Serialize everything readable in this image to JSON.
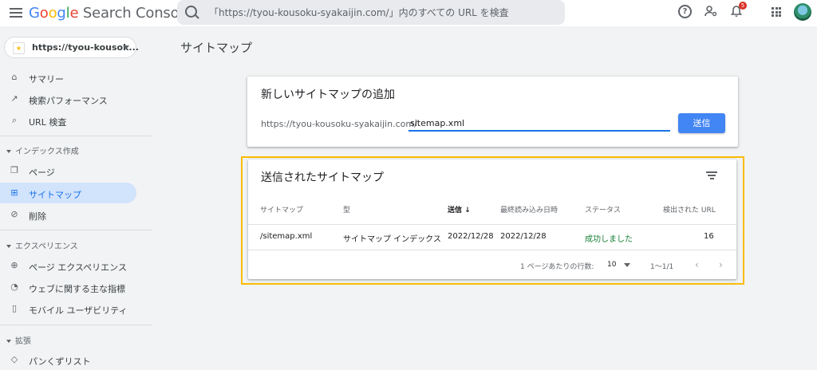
{
  "app": {
    "logo_parts": [
      "G",
      "o",
      "o",
      "g",
      "l",
      "e",
      " Search Console"
    ],
    "search_placeholder": "「https://tyou-kousoku-syakaijin.com/」内のすべての URL を検査",
    "notification_count": "5"
  },
  "sidebar": {
    "property": "https://tyou-kousok...",
    "items_top": [
      {
        "label": "サマリー",
        "icon": "home-icon"
      },
      {
        "label": "検索パフォーマンス",
        "icon": "trending-icon"
      },
      {
        "label": "URL 検査",
        "icon": "search-icon"
      }
    ],
    "section_index": "インデックス作成",
    "items_index": [
      {
        "label": "ページ",
        "icon": "pages-icon"
      },
      {
        "label": "サイトマップ",
        "icon": "sitemap-icon",
        "active": true
      },
      {
        "label": "削除",
        "icon": "removals-icon"
      }
    ],
    "section_experience": "エクスペリエンス",
    "items_experience": [
      {
        "label": "ページ エクスペリエンス",
        "icon": "plus-circle-icon"
      },
      {
        "label": "ウェブに関する主な指標",
        "icon": "speed-icon"
      },
      {
        "label": "モバイル ユーザビリティ",
        "icon": "phone-icon"
      }
    ],
    "section_enhancements": "拡張",
    "items_enhancements": [
      {
        "label": "パンくずリスト",
        "icon": "diamond-icon"
      }
    ]
  },
  "main": {
    "page_title": "サイトマップ",
    "add_card": {
      "title": "新しいサイトマップの追加",
      "prefix": "https://tyou-kousoku-syakaijin.com/",
      "input_value": "sitemap.xml",
      "submit_label": "送信"
    },
    "submitted_card": {
      "title": "送信されたサイトマップ",
      "columns": [
        "サイトマップ",
        "型",
        "送信",
        "最終読み込み日時",
        "ステータス",
        "検出された URL"
      ],
      "rows": [
        {
          "sitemap": "/sitemap.xml",
          "type": "サイトマップ インデックス",
          "submitted": "2022/12/28",
          "last_read": "2022/12/28",
          "status": "成功しました",
          "urls": "16"
        }
      ],
      "rows_per_page_label": "1 ページあたりの行数:",
      "rows_per_page": "10",
      "range": "1〜1/1"
    }
  }
}
